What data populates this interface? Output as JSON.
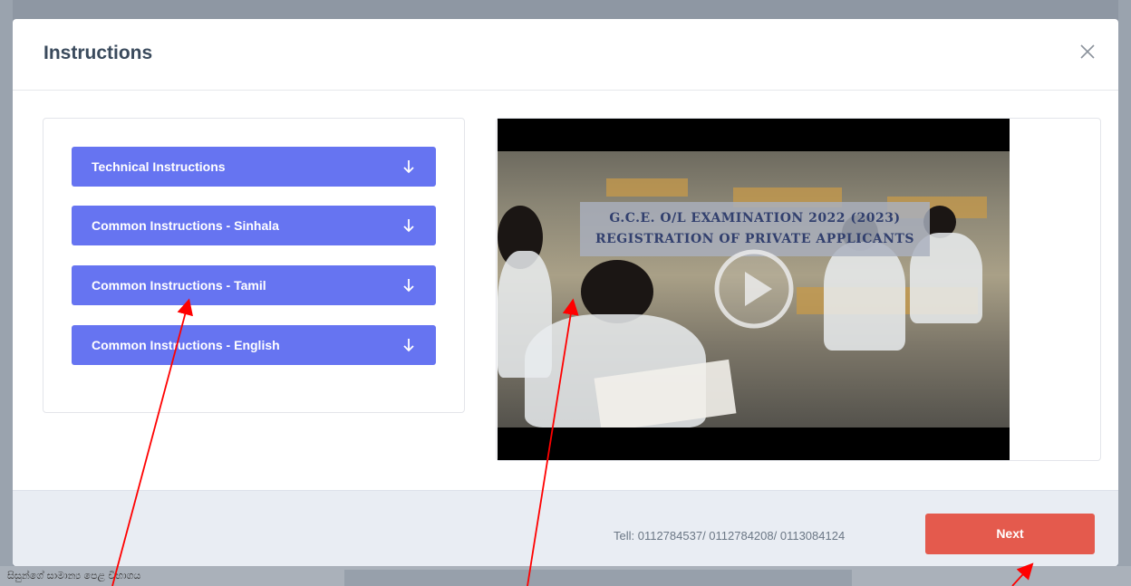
{
  "background": {
    "bottom_text": "සිසුන්ගේ සාමාන්‍ය පෙළ විභාගය"
  },
  "modal": {
    "title": "Instructions",
    "close_icon": "close-icon",
    "accordion": [
      {
        "label": "Technical Instructions",
        "icon": "arrow-down-icon"
      },
      {
        "label": "Common Instructions - Sinhala",
        "icon": "arrow-down-icon"
      },
      {
        "label": "Common Instructions - Tamil",
        "icon": "arrow-down-icon"
      },
      {
        "label": "Common Instructions - English",
        "icon": "arrow-down-icon"
      }
    ],
    "video": {
      "line1": "G.C.E. O/L EXAMINATION 2022 (2023)",
      "line2": "REGISTRATION OF PRIVATE APPLICANTS",
      "icon": "play-icon"
    },
    "footer": {
      "tel": "Tell: 0112784537/ 0112784208/ 0113084124",
      "next_label": "Next"
    }
  },
  "colors": {
    "accent_button": "#6674f1",
    "next_button": "#e45a4d",
    "annotation_arrow": "#ff0000"
  }
}
